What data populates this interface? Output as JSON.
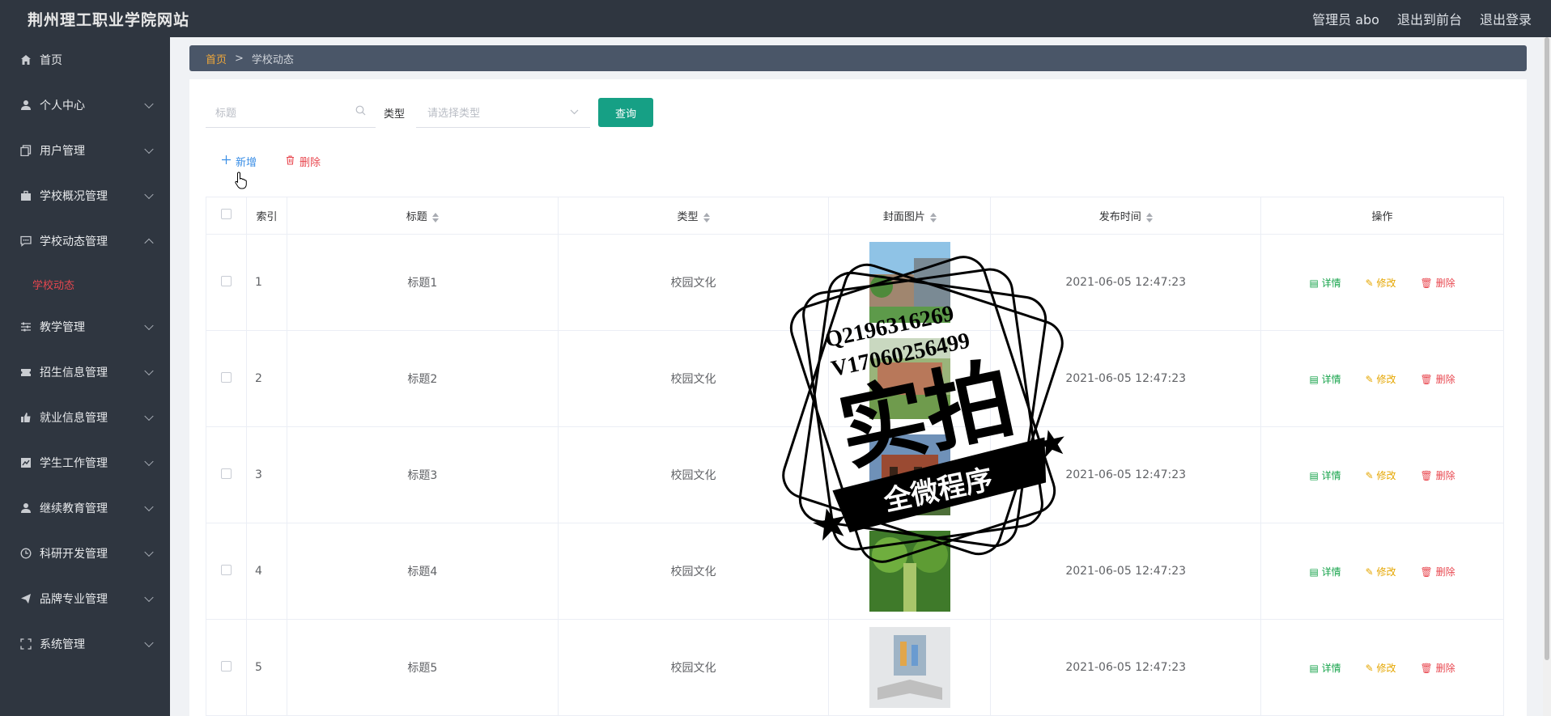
{
  "header": {
    "site_title": "荆州理工职业学院网站",
    "user": "管理员 abo",
    "back_to_front": "退出到前台",
    "logout": "退出登录"
  },
  "sidebar": {
    "items": [
      {
        "label": "首页",
        "icon": "home-icon",
        "expandable": false
      },
      {
        "label": "个人中心",
        "icon": "user-icon",
        "expandable": true
      },
      {
        "label": "用户管理",
        "icon": "copy-icon",
        "expandable": true
      },
      {
        "label": "学校概况管理",
        "icon": "briefcase-icon",
        "expandable": true
      },
      {
        "label": "学校动态管理",
        "icon": "chat-icon",
        "expandable": true,
        "expanded": true
      },
      {
        "label": "教学管理",
        "icon": "sliders-icon",
        "expandable": true
      },
      {
        "label": "招生信息管理",
        "icon": "ticket-icon",
        "expandable": true
      },
      {
        "label": "就业信息管理",
        "icon": "thumbs-up-icon",
        "expandable": true
      },
      {
        "label": "学生工作管理",
        "icon": "chart-icon",
        "expandable": true
      },
      {
        "label": "继续教育管理",
        "icon": "person-icon",
        "expandable": true
      },
      {
        "label": "科研开发管理",
        "icon": "clock-icon",
        "expandable": true
      },
      {
        "label": "品牌专业管理",
        "icon": "send-icon",
        "expandable": true
      },
      {
        "label": "系统管理",
        "icon": "fullscreen-icon",
        "expandable": true
      }
    ],
    "active_sub": "学校动态"
  },
  "breadcrumb": {
    "home": "首页",
    "sep": ">",
    "current": "学校动态"
  },
  "search": {
    "title_placeholder": "标题",
    "type_label": "类型",
    "type_placeholder": "请选择类型",
    "query_button": "查询"
  },
  "actions": {
    "add": "新增",
    "delete": "删除"
  },
  "table": {
    "headers": [
      "索引",
      "标题",
      "类型",
      "封面图片",
      "发布时间",
      "操作"
    ],
    "rows": [
      {
        "index": "1",
        "title": "标题1",
        "type": "校园文化",
        "time": "2021-06-05 12:47:23"
      },
      {
        "index": "2",
        "title": "标题2",
        "type": "校园文化",
        "time": "2021-06-05 12:47:23"
      },
      {
        "index": "3",
        "title": "标题3",
        "type": "校园文化",
        "time": "2021-06-05 12:47:23"
      },
      {
        "index": "4",
        "title": "标题4",
        "type": "校园文化",
        "time": "2021-06-05 12:47:23"
      },
      {
        "index": "5",
        "title": "标题5",
        "type": "校园文化",
        "time": "2021-06-05 12:47:23"
      }
    ],
    "op_detail": "详情",
    "op_edit": "修改",
    "op_delete": "删除"
  },
  "watermark": {
    "line1": "Q2196316269",
    "line2": "V17060256499",
    "big": "实拍",
    "banner": "全微程序"
  },
  "colors": {
    "sidebar_bg": "#2f3640",
    "accent_green": "#16a085",
    "active_red": "#e8474f",
    "breadcrumb_home": "#f0a83a"
  }
}
